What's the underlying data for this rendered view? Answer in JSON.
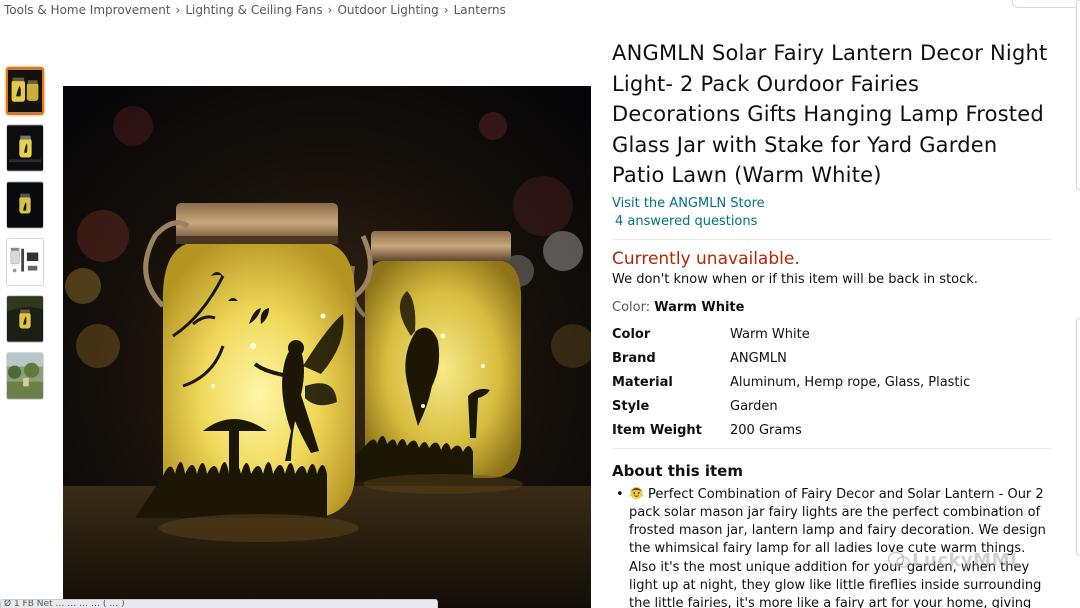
{
  "breadcrumb": [
    "Tools & Home Improvement",
    "Lighting & Ceiling Fans",
    "Outdoor Lighting",
    "Lanterns"
  ],
  "breadcrumb_separator": "›",
  "product": {
    "title": "ANGMLN Solar Fairy Lantern Decor Night Light- 2 Pack Ourdoor Fairies Decorations Gifts Hanging Lamp Frosted Glass Jar with Stake for Yard Garden Patio Lawn (Warm White)",
    "store_link": "Visit the ANGMLN Store",
    "answered_questions": "4 answered questions"
  },
  "availability": {
    "status": "Currently unavailable.",
    "note": "We don't know when or if this item will be back in stock."
  },
  "color_selection": {
    "label": "Color:",
    "value": "Warm White"
  },
  "specs": [
    {
      "key": "Color",
      "value": "Warm White"
    },
    {
      "key": "Brand",
      "value": "ANGMLN"
    },
    {
      "key": "Material",
      "value": "Aluminum, Hemp rope, Glass, Plastic"
    },
    {
      "key": "Style",
      "value": "Garden"
    },
    {
      "key": "Item Weight",
      "value": "200 Grams"
    }
  ],
  "about": {
    "title": "About this item",
    "bullets": [
      "Perfect Combination of Fairy Decor and Solar Lantern - Our 2 pack solar mason jar fairy lights are the perfect combination of frosted mason jar, lantern lamp and fairy decoration. We design the whimsical fairy lamp for all ladies love cute warm things. Also it's the most unique addition for your garden, when they light up at night, they glow like little fireflies inside surrounding the little fairies, it's more like a fairy art for your home, giving you a romantic and"
    ]
  },
  "thumbnails": [
    "jar-pair-glow",
    "jar-single-glow",
    "jar-single-dark",
    "package-contents",
    "jar-hanging-tree",
    "garden-scene"
  ],
  "watermark": "LuckyMML",
  "bottom_bar_text": "Ø 1  FB Net …  … … …  ( … )",
  "colors": {
    "link": "#007185",
    "unavailable": "#b12704",
    "thumb_active_border": "#e77600",
    "text_secondary": "#565959"
  }
}
